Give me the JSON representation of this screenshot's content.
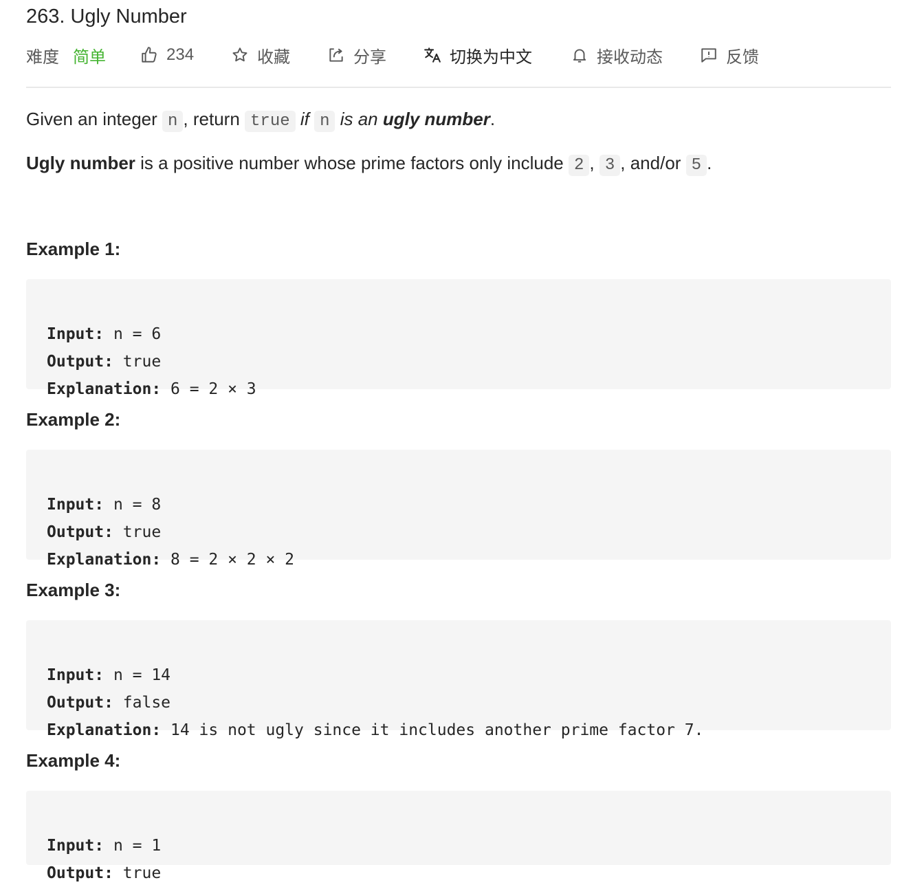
{
  "problem": {
    "number": "263.",
    "title": "Ugly Number"
  },
  "meta": {
    "difficulty_label": "难度",
    "difficulty_value": "简单",
    "likes": "234",
    "favorite": "收藏",
    "share": "分享",
    "translate": "切换为中文",
    "subscribe": "接收动态",
    "feedback": "反馈",
    "difficulty_color": "#45b432"
  },
  "description": {
    "p1": {
      "a": "Given an integer ",
      "code_n": "n",
      "b": ", return ",
      "code_true": "true",
      "c": " if ",
      "code_n2": "n",
      "d": " is an ",
      "e": "ugly number",
      "f": "."
    },
    "p2": {
      "bold": "Ugly number",
      "a": " is a positive number whose prime factors only include ",
      "c2": "2",
      "sep1": ", ",
      "c3": "3",
      "sep2": ", and/or ",
      "c5": "5",
      "end": "."
    }
  },
  "examples": [
    {
      "title": "Example 1:",
      "input_label": "Input:",
      "input": " n = 6",
      "output_label": "Output:",
      "output": " true",
      "explanation_label": "Explanation:",
      "explanation": " 6 = 2 × 3"
    },
    {
      "title": "Example 2:",
      "input_label": "Input:",
      "input": " n = 8",
      "output_label": "Output:",
      "output": " true",
      "explanation_label": "Explanation:",
      "explanation": " 8 = 2 × 2 × 2"
    },
    {
      "title": "Example 3:",
      "input_label": "Input:",
      "input": " n = 14",
      "output_label": "Output:",
      "output": " false",
      "explanation_label": "Explanation:",
      "explanation": " 14 is not ugly since it includes another prime factor 7."
    },
    {
      "title": "Example 4:",
      "input_label": "Input:",
      "input": " n = 1",
      "output_label": "Output:",
      "output": " true"
    }
  ],
  "icons": {
    "likes": "thumbs-up-icon",
    "favorite": "star-icon",
    "share": "share-icon",
    "translate": "translate-icon",
    "subscribe": "bell-icon",
    "feedback": "feedback-icon"
  }
}
